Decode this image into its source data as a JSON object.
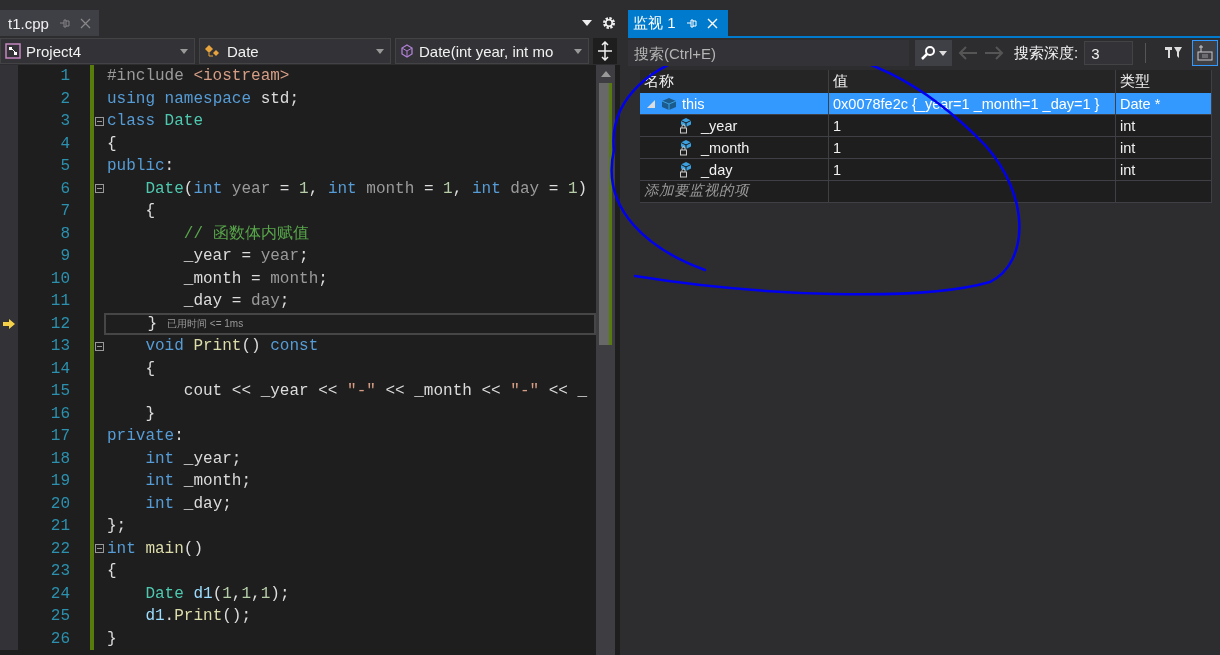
{
  "editor": {
    "tab": {
      "title": "t1.cpp"
    },
    "nav": [
      {
        "kind": "project",
        "label": "Project4"
      },
      {
        "kind": "class",
        "label": "Date"
      },
      {
        "kind": "method",
        "label": "Date(int year, int mo"
      }
    ],
    "lines": [
      {
        "number": "1",
        "fold": false,
        "current": false,
        "tokens": [
          {
            "kind": "preproc",
            "text": "#include"
          },
          {
            "kind": "string",
            "text": " <iostream>"
          }
        ]
      },
      {
        "number": "2",
        "fold": false,
        "current": false,
        "tokens": [
          {
            "kind": "keyword",
            "text": "using"
          },
          {
            "kind": "keyword",
            "text": " namespace"
          },
          {
            "kind": "plain",
            "text": " std;"
          }
        ]
      },
      {
        "number": "3",
        "fold": true,
        "current": false,
        "tokens": [
          {
            "kind": "keyword",
            "text": "class"
          },
          {
            "kind": "type",
            "text": " Date"
          }
        ]
      },
      {
        "number": "4",
        "fold": false,
        "current": false,
        "tokens": [
          {
            "kind": "plain",
            "text": "{"
          }
        ]
      },
      {
        "number": "5",
        "fold": false,
        "current": false,
        "tokens": [
          {
            "kind": "keyword",
            "text": "public"
          },
          {
            "kind": "plain",
            "text": ":"
          }
        ]
      },
      {
        "number": "6",
        "fold": true,
        "current": false,
        "tokens": [
          {
            "kind": "type",
            "text": "    Date"
          },
          {
            "kind": "plain",
            "text": "("
          },
          {
            "kind": "keyword",
            "text": "int"
          },
          {
            "kind": "param",
            "text": " year"
          },
          {
            "kind": "plain",
            "text": " = "
          },
          {
            "kind": "number",
            "text": "1"
          },
          {
            "kind": "plain",
            "text": ", "
          },
          {
            "kind": "keyword",
            "text": "int"
          },
          {
            "kind": "param",
            "text": " month"
          },
          {
            "kind": "plain",
            "text": " = "
          },
          {
            "kind": "number",
            "text": "1"
          },
          {
            "kind": "plain",
            "text": ", "
          },
          {
            "kind": "keyword",
            "text": "int"
          },
          {
            "kind": "param",
            "text": " day"
          },
          {
            "kind": "plain",
            "text": " = "
          },
          {
            "kind": "number",
            "text": "1"
          },
          {
            "kind": "plain",
            "text": ")"
          }
        ]
      },
      {
        "number": "7",
        "fold": false,
        "current": false,
        "tokens": [
          {
            "kind": "plain",
            "text": "    {"
          }
        ]
      },
      {
        "number": "8",
        "fold": false,
        "current": false,
        "tokens": [
          {
            "kind": "comment",
            "text": "        // 函数体内赋值"
          }
        ]
      },
      {
        "number": "9",
        "fold": false,
        "current": false,
        "tokens": [
          {
            "kind": "plain",
            "text": "        _year = "
          },
          {
            "kind": "param",
            "text": "year"
          },
          {
            "kind": "plain",
            "text": ";"
          }
        ]
      },
      {
        "number": "10",
        "fold": false,
        "current": false,
        "tokens": [
          {
            "kind": "plain",
            "text": "        _month = "
          },
          {
            "kind": "param",
            "text": "month"
          },
          {
            "kind": "plain",
            "text": ";"
          }
        ]
      },
      {
        "number": "11",
        "fold": false,
        "current": false,
        "tokens": [
          {
            "kind": "plain",
            "text": "        _day = "
          },
          {
            "kind": "param",
            "text": "day"
          },
          {
            "kind": "plain",
            "text": ";"
          }
        ]
      },
      {
        "number": "12",
        "fold": false,
        "current": true,
        "hint": "已用时间 <= 1ms",
        "tokens": [
          {
            "kind": "plain",
            "text": "    }"
          }
        ]
      },
      {
        "number": "13",
        "fold": true,
        "current": false,
        "tokens": [
          {
            "kind": "keyword",
            "text": "    void"
          },
          {
            "kind": "function",
            "text": " Print"
          },
          {
            "kind": "plain",
            "text": "() "
          },
          {
            "kind": "keyword",
            "text": "const"
          }
        ]
      },
      {
        "number": "14",
        "fold": false,
        "current": false,
        "tokens": [
          {
            "kind": "plain",
            "text": "    {"
          }
        ]
      },
      {
        "number": "15",
        "fold": false,
        "current": false,
        "tokens": [
          {
            "kind": "plain",
            "text": "        cout << _year << "
          },
          {
            "kind": "string",
            "text": "\"-\""
          },
          {
            "kind": "plain",
            "text": " << _month << "
          },
          {
            "kind": "string",
            "text": "\"-\""
          },
          {
            "kind": "plain",
            "text": " << _"
          }
        ]
      },
      {
        "number": "16",
        "fold": false,
        "current": false,
        "tokens": [
          {
            "kind": "plain",
            "text": "    }"
          }
        ]
      },
      {
        "number": "17",
        "fold": false,
        "current": false,
        "tokens": [
          {
            "kind": "keyword",
            "text": "private"
          },
          {
            "kind": "plain",
            "text": ":"
          }
        ]
      },
      {
        "number": "18",
        "fold": false,
        "current": false,
        "tokens": [
          {
            "kind": "keyword",
            "text": "    int"
          },
          {
            "kind": "plain",
            "text": " _year;"
          }
        ]
      },
      {
        "number": "19",
        "fold": false,
        "current": false,
        "tokens": [
          {
            "kind": "keyword",
            "text": "    int"
          },
          {
            "kind": "plain",
            "text": " _month;"
          }
        ]
      },
      {
        "number": "20",
        "fold": false,
        "current": false,
        "tokens": [
          {
            "kind": "keyword",
            "text": "    int"
          },
          {
            "kind": "plain",
            "text": " _day;"
          }
        ]
      },
      {
        "number": "21",
        "fold": false,
        "current": false,
        "tokens": [
          {
            "kind": "plain",
            "text": "};"
          }
        ]
      },
      {
        "number": "22",
        "fold": true,
        "current": false,
        "tokens": [
          {
            "kind": "keyword",
            "text": "int"
          },
          {
            "kind": "function",
            "text": " main"
          },
          {
            "kind": "plain",
            "text": "()"
          }
        ]
      },
      {
        "number": "23",
        "fold": false,
        "current": false,
        "tokens": [
          {
            "kind": "plain",
            "text": "{"
          }
        ]
      },
      {
        "number": "24",
        "fold": false,
        "current": false,
        "tokens": [
          {
            "kind": "type",
            "text": "    Date"
          },
          {
            "kind": "local",
            "text": " d1"
          },
          {
            "kind": "plain",
            "text": "("
          },
          {
            "kind": "number",
            "text": "1"
          },
          {
            "kind": "plain",
            "text": ","
          },
          {
            "kind": "number",
            "text": "1"
          },
          {
            "kind": "plain",
            "text": ","
          },
          {
            "kind": "number",
            "text": "1"
          },
          {
            "kind": "plain",
            "text": ");"
          }
        ]
      },
      {
        "number": "25",
        "fold": false,
        "current": false,
        "tokens": [
          {
            "kind": "local",
            "text": "    d1"
          },
          {
            "kind": "plain",
            "text": "."
          },
          {
            "kind": "function",
            "text": "Print"
          },
          {
            "kind": "plain",
            "text": "();"
          }
        ]
      },
      {
        "number": "26",
        "fold": false,
        "current": false,
        "tokens": [
          {
            "kind": "plain",
            "text": "}"
          }
        ]
      }
    ]
  },
  "watch": {
    "tab": {
      "title": "监视 1",
      "selected": true
    },
    "search": {
      "placeholder": "搜索(Ctrl+E)"
    },
    "depth_label": "搜索深度:",
    "depth": "3",
    "toggles": [
      {
        "kind": "pin-filter",
        "on": false
      },
      {
        "kind": "raw-view",
        "on": true
      }
    ],
    "columns": [
      "名称",
      "值",
      "类型"
    ],
    "rows": [
      {
        "kind": "object",
        "name": "this",
        "value": "0x0078fe2c {_year=1 _month=1 _day=1 }",
        "type": "Date *",
        "expanded": true,
        "selected": true,
        "children": [
          {
            "kind": "member",
            "name": "_year",
            "value": "1",
            "type": "int",
            "selected": false
          },
          {
            "kind": "member",
            "name": "_month",
            "value": "1",
            "type": "int",
            "selected": false
          },
          {
            "kind": "member",
            "name": "_day",
            "value": "1",
            "type": "int",
            "selected": false
          }
        ]
      }
    ],
    "add_placeholder": "添加要监视的项"
  }
}
